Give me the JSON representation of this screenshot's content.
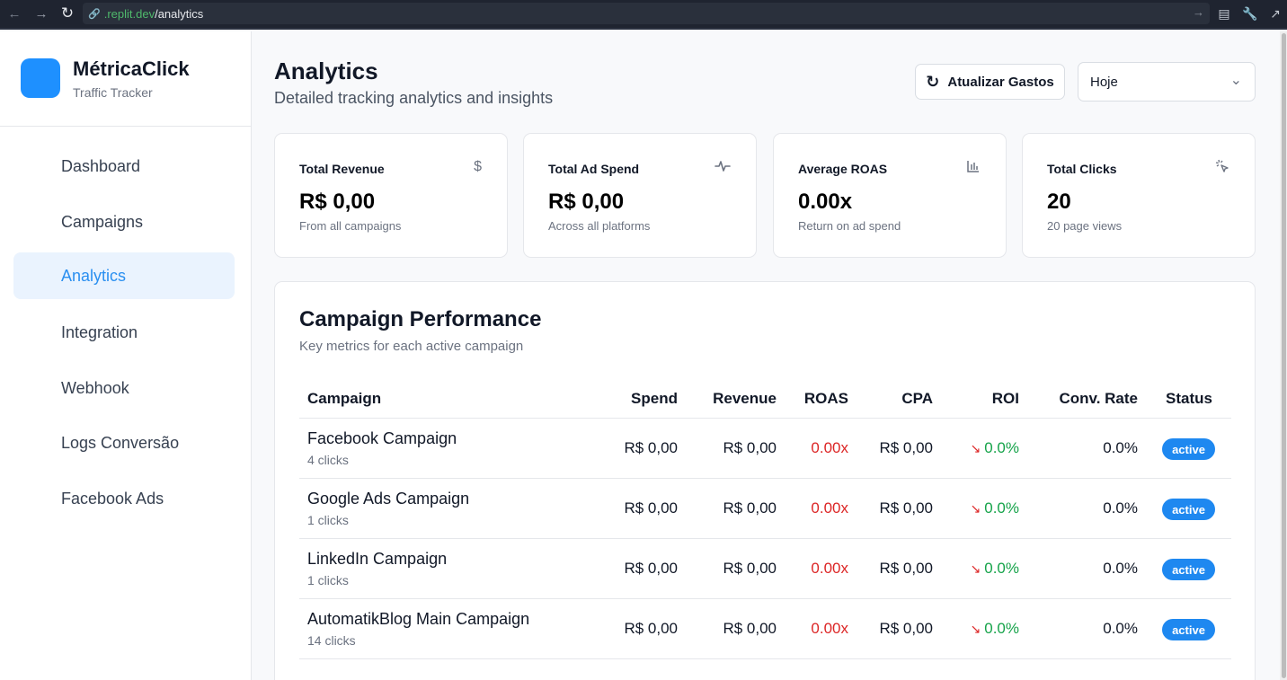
{
  "browser": {
    "url_domain": ".replit.dev",
    "url_path": "/analytics"
  },
  "sidebar": {
    "brand_name": "MétricaClick",
    "brand_sub": "Traffic Tracker",
    "items": [
      {
        "label": "Dashboard"
      },
      {
        "label": "Campaigns"
      },
      {
        "label": "Analytics",
        "active": true
      },
      {
        "label": "Integration"
      },
      {
        "label": "Webhook"
      },
      {
        "label": "Logs Conversão"
      },
      {
        "label": "Facebook Ads"
      }
    ]
  },
  "header": {
    "title": "Analytics",
    "subtitle": "Detailed tracking analytics and insights",
    "refresh_label": "Atualizar Gastos",
    "period_value": "Hoje"
  },
  "cards": [
    {
      "label": "Total Revenue",
      "value": "R$ 0,00",
      "desc": "From all campaigns",
      "icon": "dollar-icon"
    },
    {
      "label": "Total Ad Spend",
      "value": "R$ 0,00",
      "desc": "Across all platforms",
      "icon": "activity-icon"
    },
    {
      "label": "Average ROAS",
      "value": "0.00x",
      "desc": "Return on ad spend",
      "icon": "bar-chart-icon"
    },
    {
      "label": "Total Clicks",
      "value": "20",
      "desc": "20 page views",
      "icon": "cursor-click-icon"
    }
  ],
  "performance": {
    "title": "Campaign Performance",
    "subtitle": "Key metrics for each active campaign",
    "columns": [
      "Campaign",
      "Spend",
      "Revenue",
      "ROAS",
      "CPA",
      "ROI",
      "Conv. Rate",
      "Status"
    ],
    "rows": [
      {
        "name": "Facebook Campaign",
        "clicks": "4 clicks",
        "spend": "R$ 0,00",
        "revenue": "R$ 0,00",
        "roas": "0.00x",
        "cpa": "R$ 0,00",
        "roi": "0.0%",
        "conv": "0.0%",
        "status": "active"
      },
      {
        "name": "Google Ads Campaign",
        "clicks": "1 clicks",
        "spend": "R$ 0,00",
        "revenue": "R$ 0,00",
        "roas": "0.00x",
        "cpa": "R$ 0,00",
        "roi": "0.0%",
        "conv": "0.0%",
        "status": "active"
      },
      {
        "name": "LinkedIn Campaign",
        "clicks": "1 clicks",
        "spend": "R$ 0,00",
        "revenue": "R$ 0,00",
        "roas": "0.00x",
        "cpa": "R$ 0,00",
        "roi": "0.0%",
        "conv": "0.0%",
        "status": "active"
      },
      {
        "name": "AutomatikBlog Main Campaign",
        "clicks": "14 clicks",
        "spend": "R$ 0,00",
        "revenue": "R$ 0,00",
        "roas": "0.00x",
        "cpa": "R$ 0,00",
        "roi": "0.0%",
        "conv": "0.0%",
        "status": "active"
      }
    ]
  },
  "colors": {
    "accent": "#1e90ff",
    "active_nav_bg": "#eaf3fe",
    "roas_red": "#dc2626",
    "roi_green": "#16a34a"
  }
}
